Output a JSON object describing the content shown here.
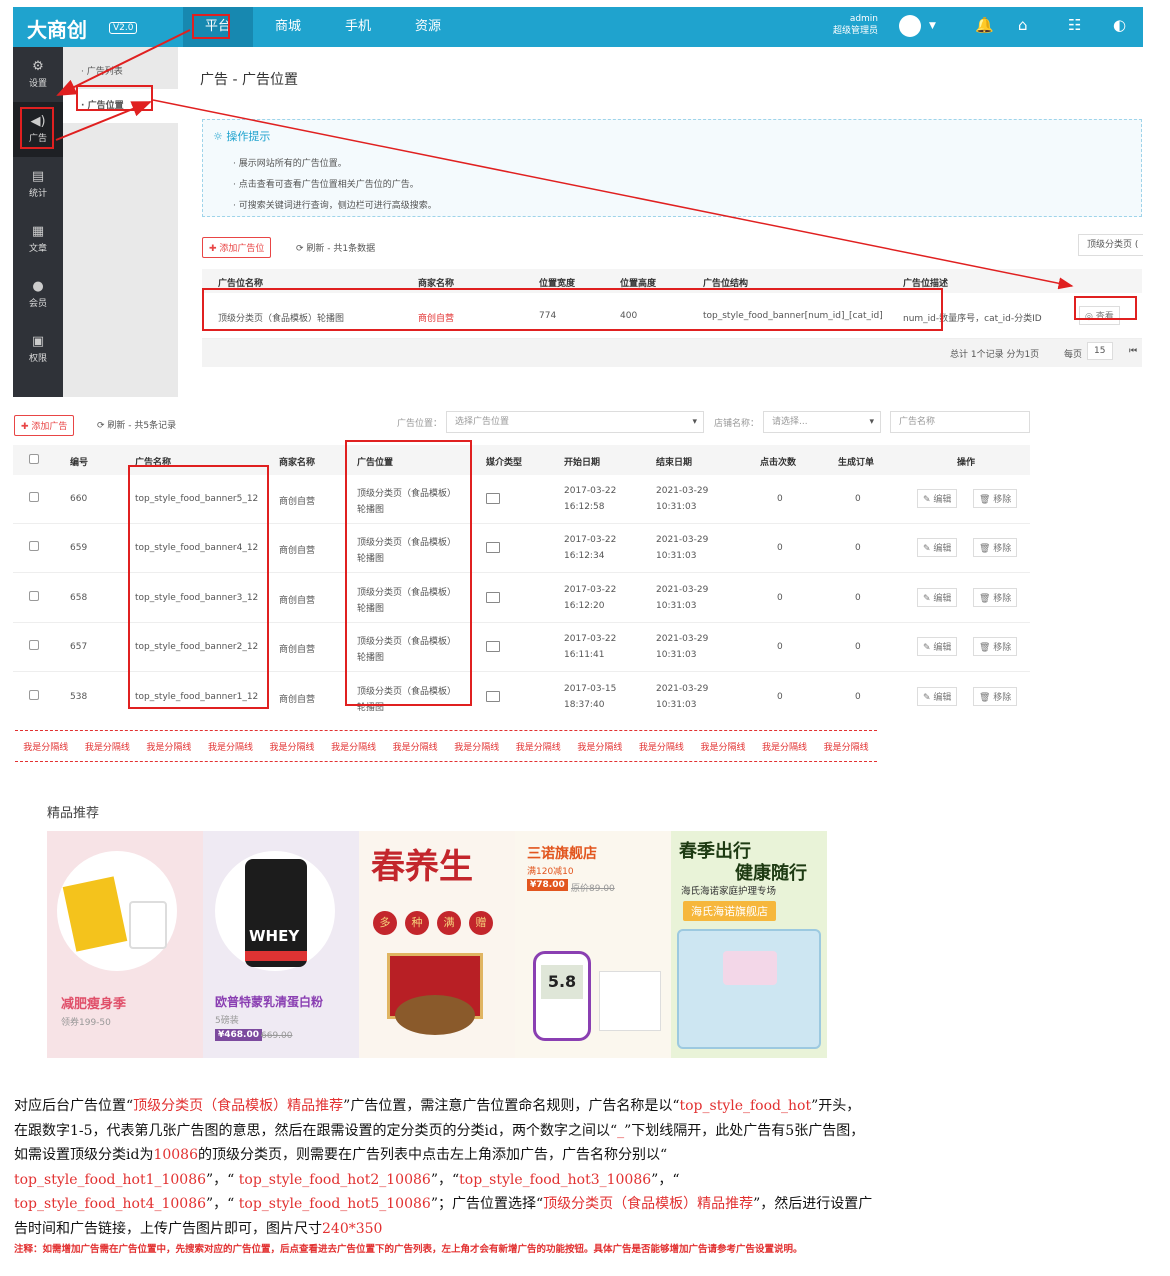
{
  "top": {
    "logo": "大商创",
    "version": "V2.0",
    "nav": [
      "平台",
      "商城",
      "手机",
      "资源"
    ],
    "user_name": "admin",
    "user_role": "超级管理员"
  },
  "sidebar": [
    {
      "label": "设置",
      "icon": "gear-icon"
    },
    {
      "label": "广告",
      "icon": "speaker-icon"
    },
    {
      "label": "统计",
      "icon": "chart-icon"
    },
    {
      "label": "文章",
      "icon": "document-icon"
    },
    {
      "label": "会员",
      "icon": "user-icon"
    },
    {
      "label": "权限",
      "icon": "lock-icon"
    }
  ],
  "subnav": [
    "广告列表",
    "广告位置"
  ],
  "page_title": "广告 - 广告位置",
  "tips": {
    "heading": "操作提示",
    "lines": [
      "展示网站所有的广告位置。",
      "点击查看可查看广告位置相关广告位的广告。",
      "可搜索关键词进行查询，侧边栏可进行高级搜索。"
    ]
  },
  "toolbar1": {
    "add": "添加广告位",
    "refresh": "刷新 - 共1条数据",
    "filter": "顶级分类页 ("
  },
  "table1": {
    "headers": [
      "广告位名称",
      "商家名称",
      "位置宽度",
      "位置高度",
      "广告位结构",
      "广告位描述"
    ],
    "row": {
      "name": "顶级分类页（食品模板）轮播图",
      "merchant": "商创自营",
      "width": "774",
      "height": "400",
      "structure": "top_style_food_banner[num_id]_[cat_id]",
      "desc": "num_id-数量序号，cat_id-分类ID",
      "action": "查看"
    },
    "footer_total": "总计 1个记录 分为1页",
    "per_page_label": "每页",
    "per_page": "15"
  },
  "toolbar2": {
    "add": "添加广告",
    "refresh": "刷新 - 共5条记录",
    "pos_label": "广告位置：",
    "pos_placeholder": "选择广告位置",
    "shop_label": "店铺名称：",
    "shop_placeholder": "请选择...",
    "name_placeholder": "广告名称"
  },
  "table2": {
    "headers": [
      "编号",
      "广告名称",
      "商家名称",
      "广告位置",
      "媒介类型",
      "开始日期",
      "结束日期",
      "点击次数",
      "生成订单",
      "操作"
    ],
    "edit": "编辑",
    "remove": "移除",
    "rows": [
      {
        "id": "660",
        "name": "top_style_food_banner5_12",
        "merchant": "商创自营",
        "pos1": "顶级分类页（食品模板）",
        "pos2": "轮播图",
        "sd": "2017-03-22",
        "st": "16:12:58",
        "ed": "2021-03-29",
        "et": "10:31:03",
        "clicks": "0",
        "orders": "0"
      },
      {
        "id": "659",
        "name": "top_style_food_banner4_12",
        "merchant": "商创自营",
        "pos1": "顶级分类页（食品模板）",
        "pos2": "轮播图",
        "sd": "2017-03-22",
        "st": "16:12:34",
        "ed": "2021-03-29",
        "et": "10:31:03",
        "clicks": "0",
        "orders": "0"
      },
      {
        "id": "658",
        "name": "top_style_food_banner3_12",
        "merchant": "商创自营",
        "pos1": "顶级分类页（食品模板）",
        "pos2": "轮播图",
        "sd": "2017-03-22",
        "st": "16:12:20",
        "ed": "2021-03-29",
        "et": "10:31:03",
        "clicks": "0",
        "orders": "0"
      },
      {
        "id": "657",
        "name": "top_style_food_banner2_12",
        "merchant": "商创自营",
        "pos1": "顶级分类页（食品模板）",
        "pos2": "轮播图",
        "sd": "2017-03-22",
        "st": "16:11:41",
        "ed": "2021-03-29",
        "et": "10:31:03",
        "clicks": "0",
        "orders": "0"
      },
      {
        "id": "538",
        "name": "top_style_food_banner1_12",
        "merchant": "商创自营",
        "pos1": "顶级分类页（食品模板）",
        "pos2": "轮播图",
        "sd": "2017-03-15",
        "st": "18:37:40",
        "ed": "2021-03-29",
        "et": "10:31:03",
        "clicks": "0",
        "orders": "0"
      }
    ]
  },
  "separator": "我是分隔线",
  "featured": {
    "title": "精品推荐",
    "banners": [
      {
        "title": "减肥瘦身季",
        "sub": "领券199-50",
        "bg": "#f7e3e6"
      },
      {
        "title": "欧普特蒙乳清蛋白粉",
        "sub": "5磅装",
        "price": "¥468.00",
        "old": "669.00",
        "product": "WHEY",
        "bg": "#efeaf3"
      },
      {
        "title": "春养生",
        "badges": [
          "多",
          "种",
          "满",
          "赠"
        ],
        "bg": "#fbf5ee"
      },
      {
        "title": "三诺旗舰店",
        "sub": "满120减10",
        "price": "¥78.00",
        "old": "原价89.00",
        "reading": "5.8",
        "bg": "#fbf7ee"
      },
      {
        "title1": "春季出行",
        "title2": "健康随行",
        "sub": "海氏海诺家庭护理专场",
        "shop": "海氏海诺旗舰店",
        "bg": "#e9f3d8"
      }
    ]
  },
  "description": {
    "p1": "对应后台广告位置“",
    "r1": "顶级分类页（食品模板）精品推荐",
    "p2": "”广告位置，需注意广告位置命名规则，广告名称是以“",
    "r2": "top_style_food_hot",
    "p3": "”开头，在跟数字1-5，代表第几张广告图的意思，然后在跟需设置的定分类页的分类id，两个数字之间以“",
    "r3": "_",
    "p4": "”下划线隔开，此处广告有5张广告图，如需设置顶级分类id为",
    "r4": "10086",
    "p5": "的顶级分类页，则需要在广告列表中点击左上角添加广告，广告名称分别以“",
    "r5": " top_style_food_hot1_10086",
    "p6": "”，“",
    "r6": " top_style_food_hot2_10086",
    "p7": "”，“",
    "r7": "top_style_food_hot3_10086",
    "p8": "”，“",
    "r8": " top_style_food_hot4_10086",
    "p9": "”，“",
    "r9": " top_style_food_hot5_10086",
    "p10": "”；广告位置选择“",
    "r10": "顶级分类页（食品模板）精品推荐",
    "p11": "”，然后进行设置广告时间和广告链接，上传广告图片即可，图片尺寸",
    "r11": "240*350"
  },
  "note": "注释：如需增加广告需在广告位置中，先搜索对应的广告位置，后点查看进去广告位置下的广告列表，左上角才会有新增广告的功能按钮。具体广告是否能够增加广告请参考广告设置说明。"
}
